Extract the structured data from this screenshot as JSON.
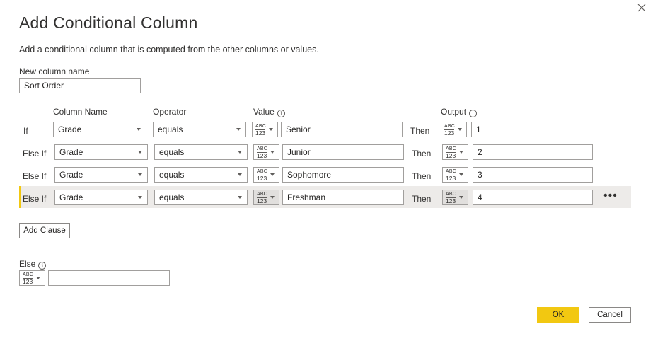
{
  "dialog": {
    "title": "Add Conditional Column",
    "subtitle": "Add a conditional column that is computed from the other columns or values."
  },
  "new_column": {
    "label": "New column name",
    "value": "Sort Order"
  },
  "headers": {
    "column_name": "Column Name",
    "operator": "Operator",
    "value": "Value",
    "output": "Output"
  },
  "type_icon": {
    "top": "ABC",
    "bottom": "123"
  },
  "clauses": [
    {
      "keyword": "If",
      "column": "Grade",
      "operator": "equals",
      "value": "Senior",
      "then": "Then",
      "output": "1"
    },
    {
      "keyword": "Else If",
      "column": "Grade",
      "operator": "equals",
      "value": "Junior",
      "then": "Then",
      "output": "2"
    },
    {
      "keyword": "Else If",
      "column": "Grade",
      "operator": "equals",
      "value": "Sophomore",
      "then": "Then",
      "output": "3"
    },
    {
      "keyword": "Else If",
      "column": "Grade",
      "operator": "equals",
      "value": "Freshman",
      "then": "Then",
      "output": "4"
    }
  ],
  "row_more": "•••",
  "buttons": {
    "add_clause": "Add Clause",
    "ok": "OK",
    "cancel": "Cancel"
  },
  "else": {
    "label": "Else",
    "value": ""
  },
  "info_glyph": "i",
  "colors": {
    "accent": "#f2c811",
    "highlight_row": "#edebe9"
  }
}
